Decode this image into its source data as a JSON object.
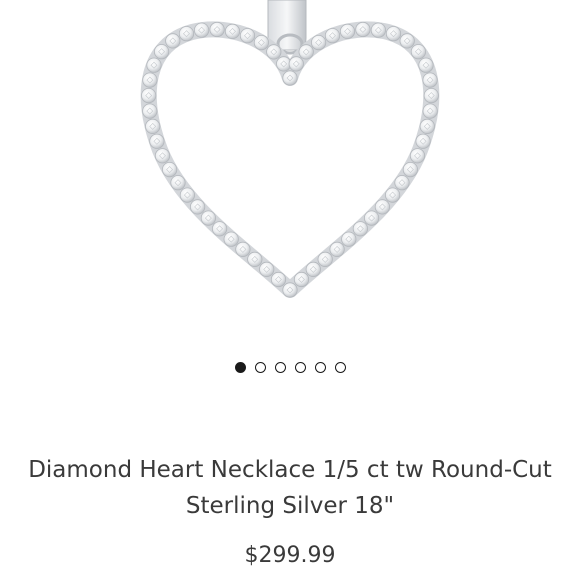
{
  "product": {
    "title": "Diamond Heart Necklace 1/5 ct tw Round-Cut Sterling Silver 18\"",
    "price": "$299.99",
    "image_icon": "heart-pendant-icon"
  },
  "carousel": {
    "total_slides": 6,
    "active_index": 0
  },
  "colors": {
    "text": "#3a3a3a",
    "dot": "#1a1a1a",
    "metal": "#c9ccd1"
  }
}
